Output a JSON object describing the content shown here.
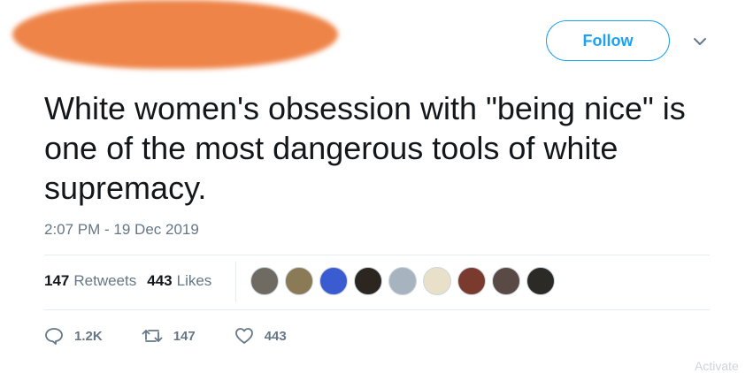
{
  "tweet": {
    "follow_label": "Follow",
    "text": "White women's obsession with \"being nice\" is one of the most dangerous tools of white supremacy.",
    "timestamp": "2:07 PM - 19 Dec 2019",
    "retweets_count": "147",
    "retweets_label": "Retweets",
    "likes_count": "443",
    "likes_label": "Likes"
  },
  "actions": {
    "replies": "1.2K",
    "retweets": "147",
    "likes": "443"
  },
  "avatars": [
    {
      "color": "#6f6a62"
    },
    {
      "color": "#8a7a55"
    },
    {
      "color": "#3b5bd0"
    },
    {
      "color": "#2b2620"
    },
    {
      "color": "#a7b4bf"
    },
    {
      "color": "#e8e0c8"
    },
    {
      "color": "#7a3b2e"
    },
    {
      "color": "#5a4a45"
    },
    {
      "color": "#2c2a26"
    }
  ],
  "colors": {
    "accent": "#1da1f2",
    "secondary_text": "#657786",
    "redaction": "#ee8448"
  },
  "watermark": "Activate"
}
